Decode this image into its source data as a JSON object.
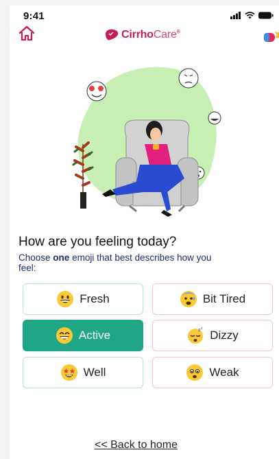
{
  "status_bar": {
    "time": "9:41"
  },
  "header": {
    "brand_name_bold": "Cirrho",
    "brand_name_light": "Care",
    "brand_tm": "®"
  },
  "main": {
    "question": "How are you feeling today?",
    "instruction_pre": "Choose ",
    "instruction_bold": "one",
    "instruction_post": " emoji that best describes how you feel:",
    "options": [
      {
        "label": "Fresh",
        "emoji": "grinning-face-icon",
        "selected": false
      },
      {
        "label": "Bit Tired",
        "emoji": "anxious-sweat-face-icon",
        "selected": false
      },
      {
        "label": "Active",
        "emoji": "beaming-face-icon",
        "selected": true
      },
      {
        "label": "Dizzy",
        "emoji": "sleeping-face-icon",
        "selected": false
      },
      {
        "label": "Well",
        "emoji": "star-struck-face-icon",
        "selected": false
      },
      {
        "label": "Weak",
        "emoji": "worried-face-icon",
        "selected": false
      }
    ],
    "back_link": "<< Back to home"
  },
  "colors": {
    "brand": "#c41e5a",
    "selected": "#1fa685",
    "left_border": "#bde3d8",
    "right_border": "#f4c6c6",
    "instruction_text": "#1f2a6b"
  }
}
